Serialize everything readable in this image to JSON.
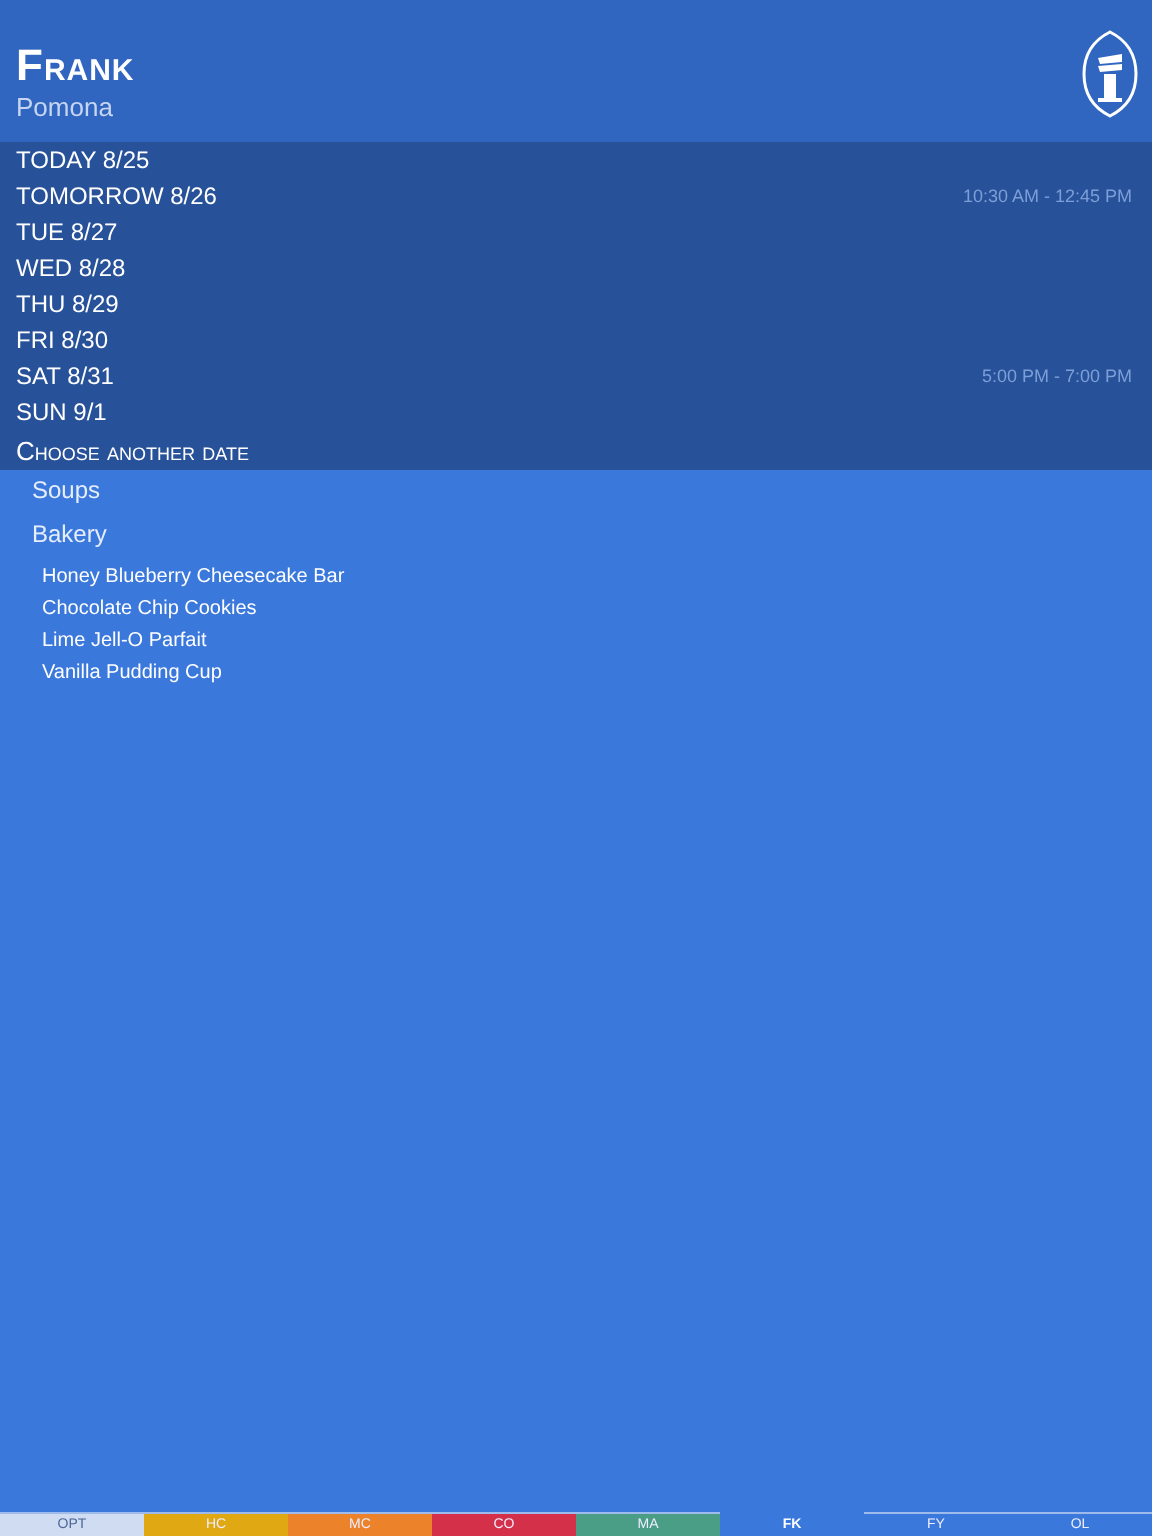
{
  "header": {
    "title": "Frank",
    "subtitle": "Pomona"
  },
  "dates": [
    {
      "label": "TODAY 8/25"
    },
    {
      "label": "TOMORROW 8/26",
      "time": "10:30 AM - 12:45 PM"
    },
    {
      "label": "TUE 8/27"
    },
    {
      "label": "WED 8/28"
    },
    {
      "label": "THU 8/29"
    },
    {
      "label": "FRI 8/30"
    },
    {
      "label": "SAT 8/31",
      "time": "5:00 PM - 7:00 PM"
    },
    {
      "label": "SUN 9/1"
    }
  ],
  "choose_date": "Choose another date",
  "sections": [
    {
      "title": "Soups"
    },
    {
      "title": "Bakery",
      "items": [
        "Honey Blueberry Cheesecake Bar",
        "Chocolate Chip Cookies",
        "Lime Jell-O Parfait",
        "Vanilla Pudding Cup"
      ]
    }
  ],
  "tabs": [
    {
      "label": "OPT",
      "color": "#d0dcf2",
      "selected": false
    },
    {
      "label": "HC",
      "color": "#e0a813",
      "selected": false
    },
    {
      "label": "MC",
      "color": "#ec8229",
      "selected": false
    },
    {
      "label": "CO",
      "color": "#d5304a",
      "selected": false
    },
    {
      "label": "MA",
      "color": "#4a9e86",
      "selected": false
    },
    {
      "label": "FK",
      "color": "#3a78dc",
      "selected": true
    },
    {
      "label": "FY",
      "color": "#3a78dc",
      "selected": false
    },
    {
      "label": "OL",
      "color": "#3a78dc",
      "selected": false
    }
  ]
}
